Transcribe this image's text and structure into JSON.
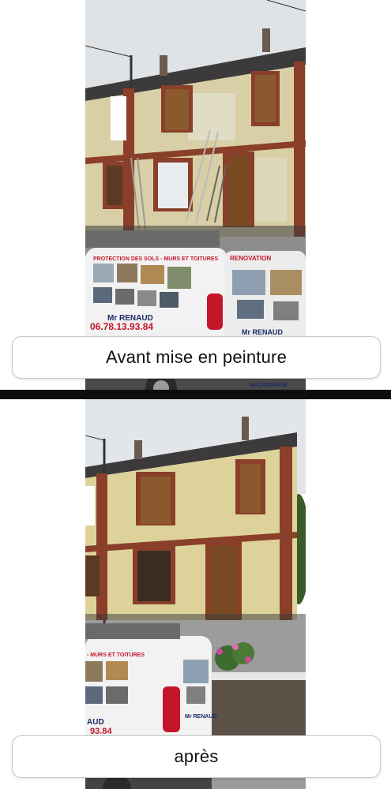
{
  "photos": [
    {
      "caption": "Avant mise en peinture",
      "van_tagline": "PROTECTION DES SOLS - MURS ET TOITURES",
      "van_phone": "06.78.13.93.84",
      "van_name": "Mr RENAUD",
      "van_badge": "RENOVATION",
      "van_side_name": "Mr RENAUD",
      "van_side_text": "MAÇONNERIE"
    },
    {
      "caption": "après",
      "van_tagline": "- MURS ET TOITURES",
      "van_phone": "93.84",
      "van_name": "AUD",
      "van_side_name": "Mr RENAUD"
    }
  ],
  "colors": {
    "facade_before": "#d8cfa6",
    "facade_after": "#ddd39a",
    "brick": "#8a3f2a",
    "van": "#f2f2f2",
    "divider": "#0d0d0d"
  }
}
